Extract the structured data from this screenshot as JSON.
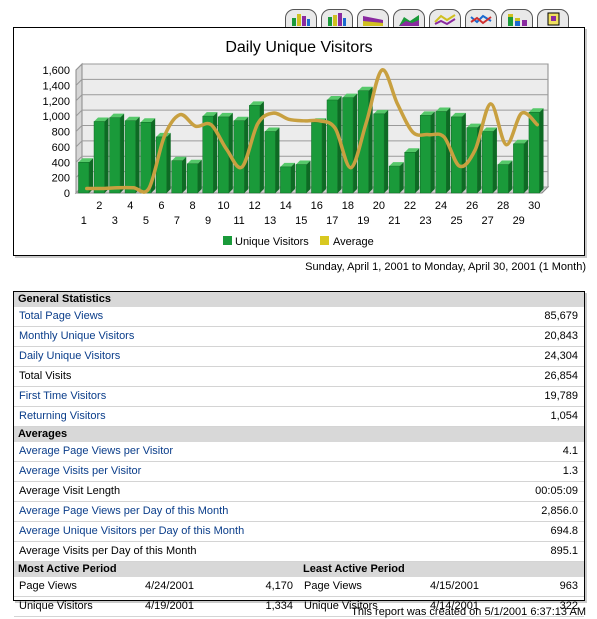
{
  "toolbar": {
    "buttons": [
      {
        "icon": "bar-chart-icon"
      },
      {
        "icon": "3d-bar-chart-icon"
      },
      {
        "icon": "area-chart-icon"
      },
      {
        "icon": "3d-area-chart-icon"
      },
      {
        "icon": "line-chart-icon"
      },
      {
        "icon": "3d-line-chart-icon"
      },
      {
        "icon": "stacked-bar-chart-icon"
      },
      {
        "icon": "export-icon"
      }
    ]
  },
  "chart_data": {
    "type": "bar",
    "title": "Daily Unique Visitors",
    "categories": [
      "1",
      "2",
      "3",
      "4",
      "5",
      "6",
      "7",
      "8",
      "9",
      "10",
      "11",
      "12",
      "13",
      "14",
      "15",
      "16",
      "17",
      "18",
      "19",
      "20",
      "21",
      "22",
      "23",
      "24",
      "25",
      "26",
      "27",
      "28",
      "29",
      "30"
    ],
    "series": [
      {
        "name": "Unique Visitors",
        "type": "bar",
        "color": "#1a9a3a",
        "values": [
          400,
          930,
          980,
          940,
          920,
          730,
          420,
          380,
          1000,
          990,
          940,
          1140,
          800,
          340,
          370,
          920,
          1210,
          1240,
          1330,
          1030,
          350,
          530,
          1010,
          1060,
          990,
          850,
          800,
          370,
          640,
          1050
        ]
      },
      {
        "name": "Average",
        "type": "line",
        "color": "#c8a040",
        "values": [
          20,
          20,
          30,
          30,
          20,
          700,
          980,
          830,
          850,
          530,
          300,
          860,
          1000,
          920,
          900,
          900,
          800,
          290,
          880,
          1560,
          1120,
          750,
          720,
          690,
          310,
          520,
          1120,
          590,
          1000,
          850
        ]
      }
    ],
    "y_ticks": [
      "0",
      "200",
      "400",
      "600",
      "800",
      "1,000",
      "1,200",
      "1,400",
      "1,600"
    ],
    "ylim": [
      0,
      1600
    ],
    "grid": true,
    "legend_position": "bottom"
  },
  "date_range": "Sunday, April 1, 2001 to Monday, April 30, 2001 (1 Month)",
  "general": {
    "title": "General Statistics",
    "rows": [
      {
        "label": "Total Page Views",
        "value": "85,679",
        "link": true
      },
      {
        "label": "Monthly Unique Visitors",
        "value": "20,843",
        "link": true
      },
      {
        "label": "Daily Unique Visitors",
        "value": "24,304",
        "link": true
      },
      {
        "label": "Total Visits",
        "value": "26,854",
        "link": false
      },
      {
        "label": "First Time Visitors",
        "value": "19,789",
        "link": true
      },
      {
        "label": "Returning Visitors",
        "value": "1,054",
        "link": true
      }
    ]
  },
  "averages": {
    "title": "Averages",
    "rows": [
      {
        "label": "Average Page Views per Visitor",
        "value": "4.1",
        "link": true
      },
      {
        "label": "Average Visits per Visitor",
        "value": "1.3",
        "link": true
      },
      {
        "label": "Average Visit Length",
        "value": "00:05:09",
        "link": false
      },
      {
        "label": "Average Page Views per Day of this Month",
        "value": "2,856.0",
        "link": true
      },
      {
        "label": "Average Unique Visitors per Day of this Month",
        "value": "694.8",
        "link": true
      },
      {
        "label": "Average Visits per Day of this Month",
        "value": "895.1",
        "link": false
      }
    ]
  },
  "most_active": {
    "title": "Most Active Period",
    "rows": [
      {
        "label": "Page Views",
        "date": "4/24/2001",
        "value": "4,170"
      },
      {
        "label": "Unique Visitors",
        "date": "4/19/2001",
        "value": "1,334"
      }
    ]
  },
  "least_active": {
    "title": "Least Active Period",
    "rows": [
      {
        "label": "Page Views",
        "date": "4/15/2001",
        "value": "963"
      },
      {
        "label": "Unique Visitors",
        "date": "4/14/2001",
        "value": "322"
      }
    ]
  },
  "footer": "This report was created on 5/1/2001  6:37:13 AM"
}
